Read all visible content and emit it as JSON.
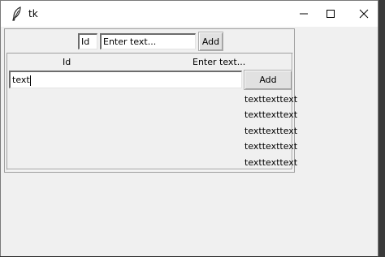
{
  "window": {
    "title": "tk",
    "controls": {
      "minimize": "minimize-icon",
      "maximize": "maximize-icon",
      "close": "close-icon"
    }
  },
  "top_bar": {
    "id_field_value": "Id",
    "text_field_value": "Enter text...",
    "add_label": "Add"
  },
  "table": {
    "headers": [
      "Id",
      "Enter text..."
    ],
    "input_value": "text",
    "add_label": "Add",
    "items": [
      "texttexttext",
      "texttexttext",
      "texttexttext",
      "texttexttext",
      "texttexttext"
    ]
  }
}
